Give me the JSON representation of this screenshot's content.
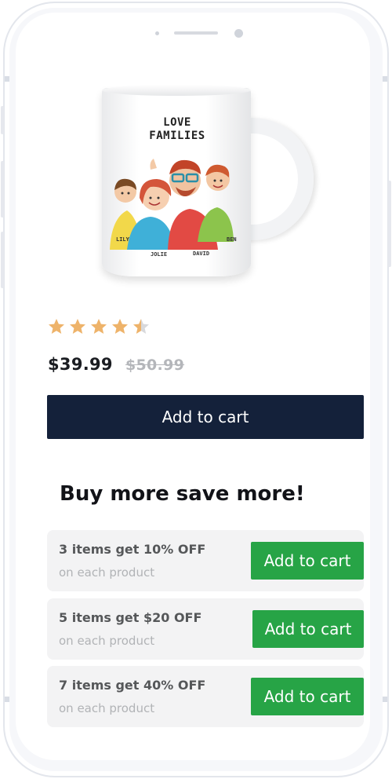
{
  "product": {
    "mug_title_line1": "LOVE",
    "mug_title_line2": "FAMILIES",
    "mug_names": [
      "LILY",
      "JOLIE",
      "DAVID",
      "BEN"
    ],
    "rating": 4.5,
    "rating_max": 5,
    "price": "$39.99",
    "compare_price": "$50.99",
    "add_to_cart_label": "Add to cart"
  },
  "bundle": {
    "title": "Buy more save more!",
    "offers": [
      {
        "title": "3 items get 10% OFF",
        "subtitle": "on each product",
        "button": "Add to cart"
      },
      {
        "title": "5 items get $20 OFF",
        "subtitle": "on each product",
        "button": "Add to cart"
      },
      {
        "title": "7 items get 40% OFF",
        "subtitle": "on each product",
        "button": "Add to cart"
      }
    ]
  },
  "colors": {
    "primary_button": "#14213a",
    "offer_button": "#27a446",
    "star": "#eeb36a"
  },
  "icons": [
    "star-icon",
    "half-star-icon"
  ]
}
